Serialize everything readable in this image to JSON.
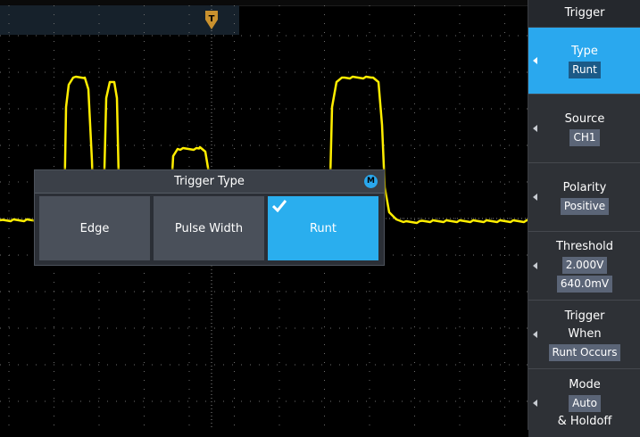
{
  "side_menu": {
    "title": "Trigger",
    "items": [
      {
        "label": "Type",
        "values": [
          "Runt"
        ],
        "active": true
      },
      {
        "label": "Source",
        "values": [
          "CH1"
        ]
      },
      {
        "label": "Polarity",
        "values": [
          "Positive"
        ]
      },
      {
        "label": "Threshold",
        "values": [
          "2.000V",
          "640.0mV"
        ]
      },
      {
        "label_lines": [
          "Trigger",
          "When"
        ],
        "values": [
          "Runt Occurs"
        ]
      },
      {
        "label": "Mode",
        "values": [
          "Auto"
        ],
        "label_after": "& Holdoff"
      }
    ]
  },
  "dialog": {
    "title": "Trigger Type",
    "badge": "M",
    "options": [
      {
        "label": "Edge"
      },
      {
        "label": "Pulse Width"
      },
      {
        "label": "Runt",
        "selected": true
      }
    ]
  },
  "trigger_marker": {
    "label": "T"
  },
  "colors": {
    "trace": "#ffee00",
    "accent": "#2aa8ee",
    "grid": "#6e6e6e",
    "background": "#000000"
  },
  "icons": {
    "trigger_marker": "trigger-position-icon",
    "check": "check-icon",
    "arrow": "left-arrow-icon"
  }
}
